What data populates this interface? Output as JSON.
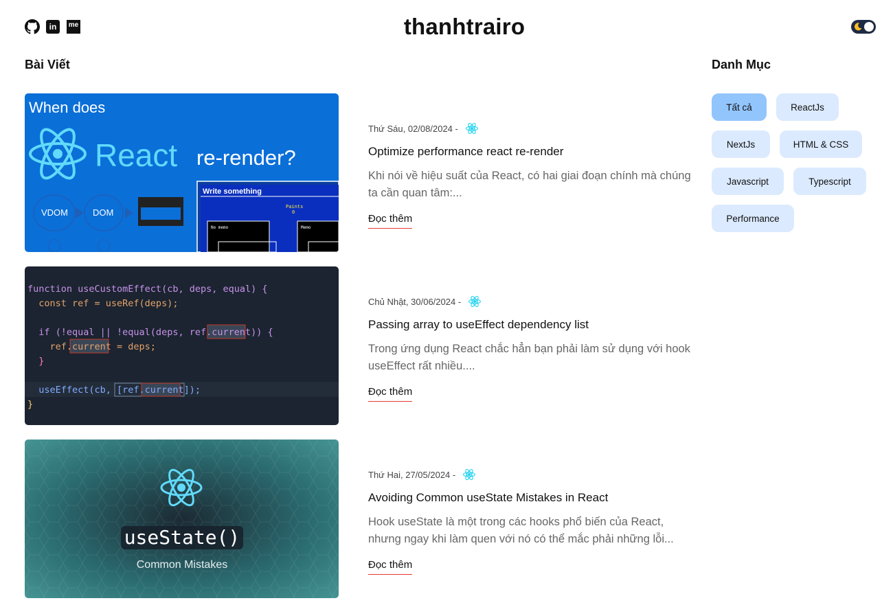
{
  "site": {
    "title": "thanhtrairo"
  },
  "social": {
    "linkedin_label": "in",
    "medium_label": "me"
  },
  "posts_section": {
    "title": "Bài Viết"
  },
  "categories_section": {
    "title": "Danh Mục"
  },
  "categories": [
    {
      "label": "Tất cả",
      "active": true
    },
    {
      "label": "ReactJs",
      "active": false
    },
    {
      "label": "NextJs",
      "active": false
    },
    {
      "label": "HTML & CSS",
      "active": false
    },
    {
      "label": "Javascript",
      "active": false
    },
    {
      "label": "Typescript",
      "active": false
    },
    {
      "label": "Performance",
      "active": false
    }
  ],
  "posts": [
    {
      "date": "Thứ Sáu, 02/08/2024 -",
      "title": "Optimize performance react re-render",
      "excerpt": "Khi nói về hiệu suất của React, có hai giai đoạn chính mà chúng ta cần quan tâm:...",
      "read_more": "Đọc thêm",
      "thumb": {
        "heading": "When does",
        "brand": "React",
        "suffix": "re-render?",
        "vdom": "VDOM",
        "dom": "DOM",
        "window_title": "Write something",
        "paints": "Paints",
        "paints_value": "0",
        "no_memo": "No memo",
        "memo": "Memo"
      }
    },
    {
      "date": "Chủ Nhật, 30/06/2024 -",
      "title": "Passing array to useEffect dependency list",
      "excerpt": "Trong ứng dụng React chắc hẳn bạn phải làm sử dụng với hook useEffect rất nhiều....",
      "read_more": "Đọc thêm",
      "thumb": {
        "code": [
          "function useCustomEffect(cb, deps, equal) {",
          "  const ref = useRef(deps);",
          "",
          "  if (!equal || !equal(deps, ref.current)) {",
          "    ref.current = deps;",
          "  }",
          "",
          "  useEffect(cb, [ref.current]);",
          "}"
        ]
      }
    },
    {
      "date": "Thứ Hai, 27/05/2024 -",
      "title": "Avoiding Common useState Mistakes in React",
      "excerpt": "Hook useState là một trong các hooks phổ biến của React, nhưng ngay khi làm quen với nó có thể mắc phải những lỗi...",
      "read_more": "Đọc thêm",
      "thumb": {
        "code_title": "useState()",
        "subtitle": "Common Mistakes"
      }
    }
  ],
  "colors": {
    "accent_underline": "#e53935",
    "chip_bg": "#dbeafe",
    "chip_active_bg": "#93c5fd",
    "react_cyan": "#22d3ee"
  }
}
